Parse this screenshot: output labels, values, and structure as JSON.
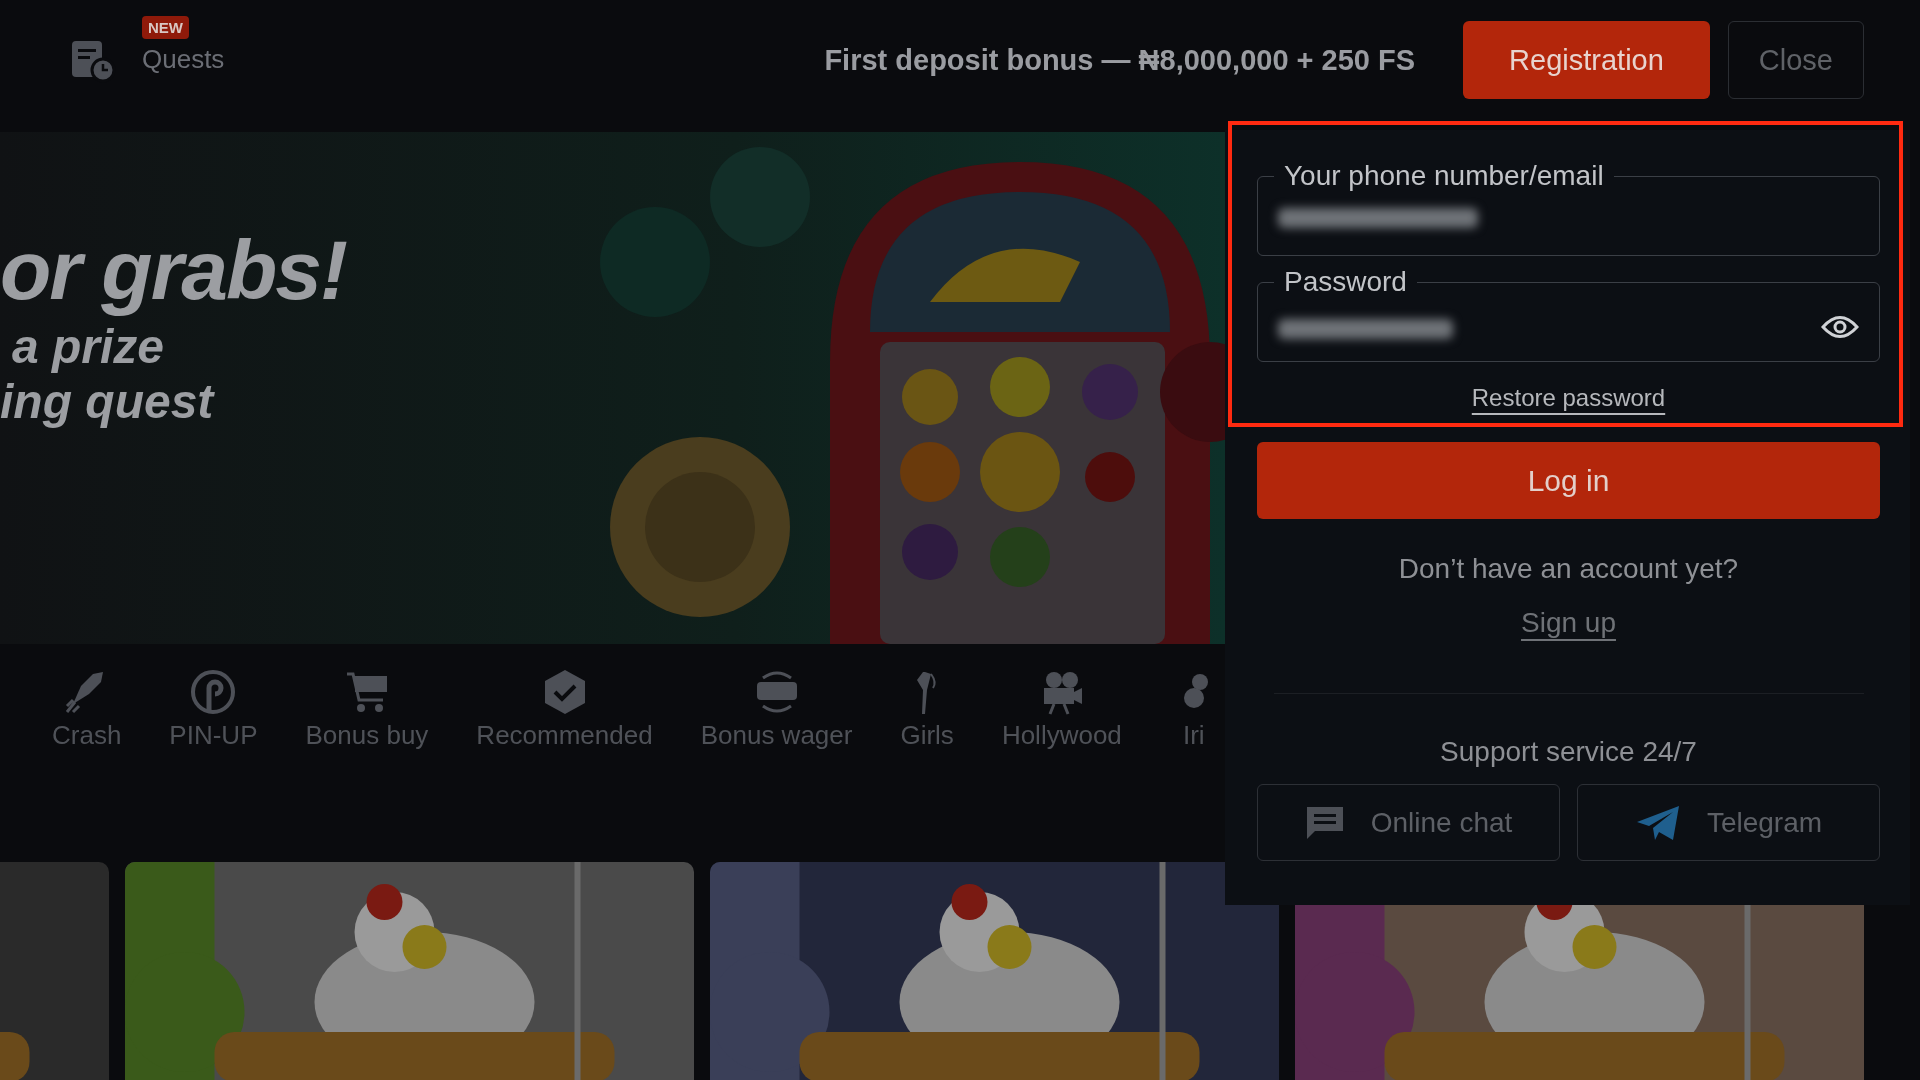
{
  "top_bar": {
    "nav_items": [
      {
        "label": "Quests",
        "badge": "NEW"
      }
    ],
    "promo": "First deposit bonus — ₦8,000,000 + 250 FS",
    "buttons": [
      {
        "label": "Registration",
        "kind": "primary"
      },
      {
        "label": "Close",
        "kind": "outline"
      }
    ]
  },
  "banner": {
    "kind": "picture",
    "lines": [
      "or grabs!",
      "a prize",
      "ing quest"
    ]
  },
  "categories": [
    {
      "label": "Crash"
    },
    {
      "label": "PIN-UP"
    },
    {
      "label": "Bonus buy"
    },
    {
      "label": "Recommended"
    },
    {
      "label": "Bonus wager"
    },
    {
      "label": "Girls"
    },
    {
      "label": "Hollywood"
    },
    {
      "label": "Iri"
    }
  ],
  "login": {
    "fields": [
      {
        "label": "Your phone number/email",
        "kind": "text"
      },
      {
        "label": "Password",
        "kind": "password"
      }
    ],
    "restore_link": "Restore password",
    "submit": "Log in",
    "signup_prompt": "Don’t have an account yet?",
    "signup_link": "Sign up",
    "support_title": "Support service 24/7",
    "support_buttons": [
      {
        "label": "Online chat",
        "kind": "chat"
      },
      {
        "label": "Telegram",
        "kind": "telegram"
      }
    ]
  }
}
